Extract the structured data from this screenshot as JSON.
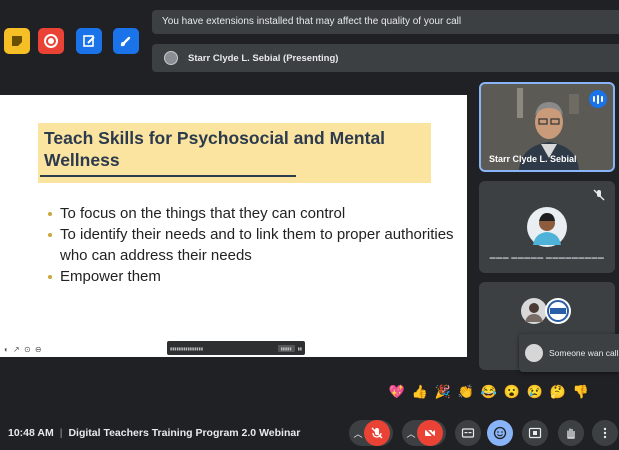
{
  "notifications": {
    "extensions_warning": "You have extensions installed that may affect the quality of your call",
    "presenting": "Starr Clyde L. Sebial (Presenting)"
  },
  "slide": {
    "title": "Teach Skills for Psychosocial and Mental Wellness",
    "bullets": [
      "To focus on the things that they can control",
      "To identify their needs and to link them to proper authorities who can address their needs",
      "Empower them"
    ],
    "tools_glyphs": "◐ ↗ ⊙ ⊖"
  },
  "participants": [
    {
      "name": "Starr Clyde L. Sebial",
      "speaking": true,
      "muted": false
    },
    {
      "name": "",
      "speaking": false,
      "muted": true
    },
    {
      "name": "",
      "speaking": false,
      "muted": false
    }
  ],
  "toast": {
    "text": "Someone wan call"
  },
  "reactions": [
    "💖",
    "👍",
    "🎉",
    "👏",
    "😂",
    "😮",
    "😢",
    "🤔",
    "👎"
  ],
  "meeting": {
    "time": "10:48 AM",
    "separator": "|",
    "title": "Digital Teachers Training Program 2.0 Webinar"
  },
  "colors": {
    "background": "#202124",
    "danger": "#ea4335",
    "accent": "#8ab4f8",
    "title_band": "#fbe4a0"
  }
}
